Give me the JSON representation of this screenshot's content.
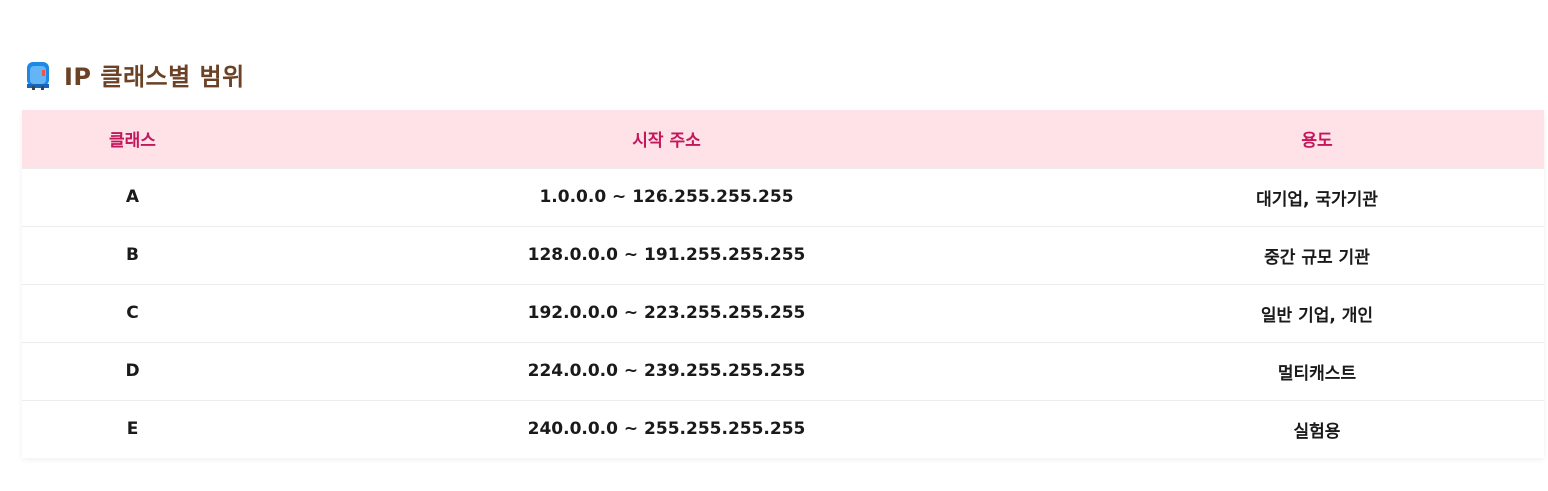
{
  "section": {
    "icon": "mailbox-icon",
    "title": "IP 클래스별 범위"
  },
  "table": {
    "columns": [
      "클래스",
      "시작 주소",
      "용도"
    ],
    "rows": [
      {
        "class": "A",
        "range": "1.0.0.0 ~ 126.255.255.255",
        "usage": "대기업, 국가기관"
      },
      {
        "class": "B",
        "range": "128.0.0.0 ~ 191.255.255.255",
        "usage": "중간 규모 기관"
      },
      {
        "class": "C",
        "range": "192.0.0.0 ~ 223.255.255.255",
        "usage": "일반 기업, 개인"
      },
      {
        "class": "D",
        "range": "224.0.0.0 ~ 239.255.255.255",
        "usage": "멀티캐스트"
      },
      {
        "class": "E",
        "range": "240.0.0.0 ~ 255.255.255.255",
        "usage": "실험용"
      }
    ]
  },
  "colors": {
    "title": "#6b4226",
    "header_bg": "#ffe1e8",
    "header_text": "#c2185b",
    "cell_text": "#1a1a1a"
  }
}
